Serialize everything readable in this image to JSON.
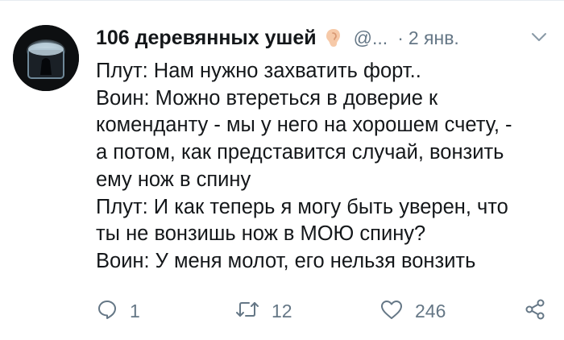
{
  "tweet": {
    "author": {
      "display_name": "106 деревянных ушей",
      "handle": "@...",
      "name_icon": "ear-icon"
    },
    "separator": "·",
    "date": "2 янв.",
    "lines": [
      "Плут: Нам нужно захватить форт..",
      "Воин: Можно втереться в доверие к",
      "коменданту - мы у него на хорошем счету, -",
      "а потом, как представится случай, вонзить",
      "ему нож в спину",
      "Плут: И как теперь я могу быть уверен, что",
      "ты не вонзишь нож в МОЮ спину?",
      "Воин: У меня молот, его нельзя вонзить"
    ],
    "actions": {
      "reply": {
        "icon": "reply-icon",
        "count": "1"
      },
      "retweet": {
        "icon": "retweet-icon",
        "count": "12"
      },
      "like": {
        "icon": "heart-icon",
        "count": "246"
      },
      "share": {
        "icon": "share-icon"
      }
    },
    "menu_icon": "chevron-down-icon"
  },
  "colors": {
    "text": "#14171a",
    "secondary": "#657786",
    "divider": "#e6ecf0"
  }
}
